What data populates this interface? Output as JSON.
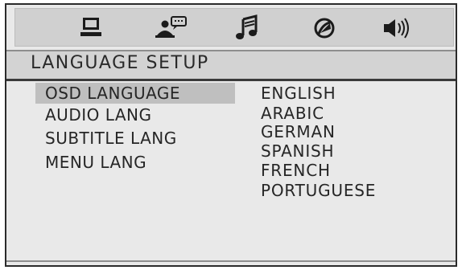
{
  "icons": [
    {
      "name": "system-setup-icon"
    },
    {
      "name": "language-setup-icon"
    },
    {
      "name": "audio-setup-icon"
    },
    {
      "name": "video-setup-icon"
    },
    {
      "name": "speaker-setup-icon"
    }
  ],
  "page": {
    "title": "LANGUAGE SETUP"
  },
  "menu": {
    "items": [
      {
        "label": "OSD LANGUAGE",
        "selected": true
      },
      {
        "label": "AUDIO LANG",
        "selected": false
      },
      {
        "label": "SUBTITLE LANG",
        "selected": false
      },
      {
        "label": "MENU LANG",
        "selected": false
      }
    ]
  },
  "options": {
    "items": [
      {
        "label": "ENGLISH"
      },
      {
        "label": "ARABIC"
      },
      {
        "label": "GERMAN"
      },
      {
        "label": "SPANISH"
      },
      {
        "label": "FRENCH"
      },
      {
        "label": "PORTUGUESE"
      }
    ]
  }
}
